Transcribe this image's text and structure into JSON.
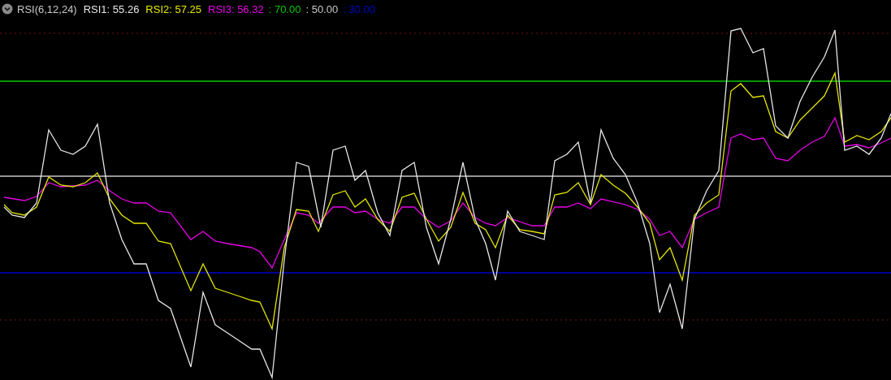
{
  "indicator": {
    "title": "RSI(6,12,24)",
    "legend": [
      {
        "kind": "series",
        "text": "RSI1: 55.26",
        "color": "#e6e6e6"
      },
      {
        "kind": "series",
        "text": "RSI2: 57.25",
        "color": "#e6e600"
      },
      {
        "kind": "series",
        "text": "RSI3: 56.32",
        "color": "#e600e6"
      },
      {
        "kind": "level",
        "text": ": 70.00",
        "color": "#00c800"
      },
      {
        "kind": "level",
        "text": ": 50.00",
        "color": "#c8c8c8"
      },
      {
        "kind": "level",
        "text": ": 30.00",
        "color": "#0000c8"
      }
    ]
  }
}
